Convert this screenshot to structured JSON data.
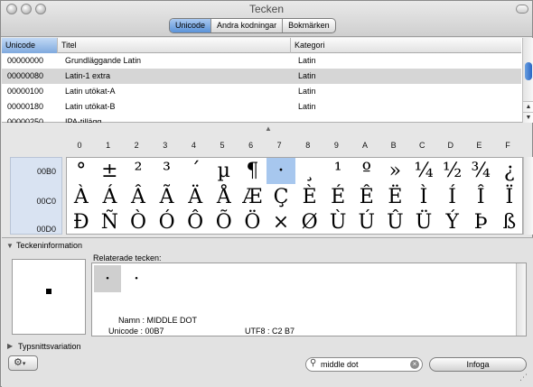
{
  "window": {
    "title": "Tecken"
  },
  "tabs": [
    {
      "label": "Unicode",
      "active": true
    },
    {
      "label": "Andra kodningar",
      "active": false
    },
    {
      "label": "Bokmärken",
      "active": false
    }
  ],
  "table": {
    "columns": [
      "Unicode",
      "Titel",
      "Kategori"
    ],
    "rows": [
      {
        "code": "00000000",
        "title": "Grundläggande Latin",
        "category": "Latin"
      },
      {
        "code": "00000080",
        "title": "Latin-1 extra",
        "category": "Latin",
        "selected": true
      },
      {
        "code": "00000100",
        "title": "Latin utökat-A",
        "category": "Latin"
      },
      {
        "code": "00000180",
        "title": "Latin utökat-B",
        "category": "Latin"
      },
      {
        "code": "00000250",
        "title": "IPA-tillägg",
        "category": ""
      }
    ]
  },
  "grid": {
    "hex_headers": [
      "0",
      "1",
      "2",
      "3",
      "4",
      "5",
      "6",
      "7",
      "8",
      "9",
      "A",
      "B",
      "C",
      "D",
      "E",
      "F"
    ],
    "row_labels": [
      "00B0",
      "00C0",
      "00D0"
    ],
    "rows": [
      [
        "°",
        "±",
        "²",
        "³",
        "´",
        "µ",
        "¶",
        "·",
        "¸",
        "¹",
        "º",
        "»",
        "¼",
        "½",
        "¾",
        "¿"
      ],
      [
        "À",
        "Á",
        "Â",
        "Ã",
        "Ä",
        "Å",
        "Æ",
        "Ç",
        "È",
        "É",
        "Ê",
        "Ë",
        "Ì",
        "Í",
        "Î",
        "Ï"
      ],
      [
        "Ð",
        "Ñ",
        "Ò",
        "Ó",
        "Ô",
        "Õ",
        "Ö",
        "×",
        "Ø",
        "Ù",
        "Ú",
        "Û",
        "Ü",
        "Ý",
        "Þ",
        "ß"
      ]
    ],
    "selected": {
      "row": 0,
      "col": 7
    }
  },
  "info": {
    "section_title": "Teckeninformation",
    "related_label": "Relaterade tecken:",
    "related_chars": [
      "·",
      "·"
    ],
    "name_label": "Namn : MIDDLE DOT",
    "unicode_label": "Unicode : 00B7",
    "utf8_label": "UTF8 : C2 B7",
    "variation_title": "Typsnittsvariation"
  },
  "footer": {
    "search_value": "middle dot",
    "insert_label": "Infoga",
    "gear_icon": "gear-icon"
  }
}
